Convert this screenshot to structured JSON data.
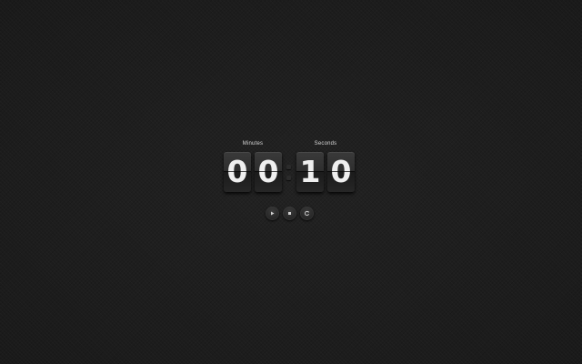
{
  "timer": {
    "minutes_label": "Minutes",
    "seconds_label": "Seconds",
    "minutes_digits": [
      "0",
      "0"
    ],
    "seconds_digits": [
      "1",
      "0"
    ]
  },
  "controls": {
    "play_icon": "play-icon",
    "stop_icon": "stop-icon",
    "reset_icon": "reset-icon"
  },
  "colors": {
    "background": "#1d1d1d",
    "digit_text": "#efefef",
    "label_text": "#d6d6d6"
  }
}
